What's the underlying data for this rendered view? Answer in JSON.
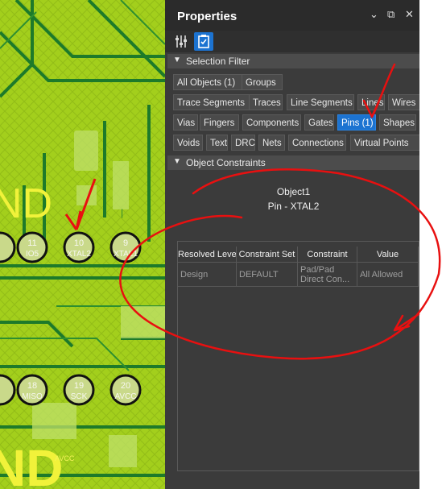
{
  "pcb": {
    "pins_top": [
      {
        "number": "11",
        "label": "IO5"
      },
      {
        "number": "10",
        "label": "XTAL2"
      },
      {
        "number": "9",
        "label": "XTAL1"
      }
    ],
    "pins_bottom": [
      {
        "number": "18",
        "label": "MISO"
      },
      {
        "number": "19",
        "label": "SCK"
      },
      {
        "number": "20",
        "label": "AVCC"
      }
    ],
    "big_text_top": "ND",
    "big_text_bottom": "ND",
    "small_avcc": "AVCC"
  },
  "panel": {
    "title": "Properties",
    "window_buttons": {
      "pin": "⌄",
      "restore": "⧉",
      "close": "✕"
    },
    "toolbar_icons": [
      "sliders-icon",
      "clipboard-check-icon"
    ],
    "selection_filter": {
      "header": "Selection Filter",
      "chips": [
        {
          "label": "All Objects (1)",
          "active": false
        },
        {
          "label": "Groups",
          "active": false
        },
        {
          "label": "Trace Segments",
          "active": false
        },
        {
          "label": "Traces",
          "active": false
        },
        {
          "label": "Line Segments",
          "active": false
        },
        {
          "label": "Lines",
          "active": false
        },
        {
          "label": "Wires",
          "active": false
        },
        {
          "label": "Vias",
          "active": false
        },
        {
          "label": "Fingers",
          "active": false
        },
        {
          "label": "Components",
          "active": false
        },
        {
          "label": "Gates",
          "active": false
        },
        {
          "label": "Pins (1)",
          "active": true
        },
        {
          "label": "Shapes",
          "active": false
        },
        {
          "label": "Voids",
          "active": false
        },
        {
          "label": "Text",
          "active": false
        },
        {
          "label": "DRC",
          "active": false
        },
        {
          "label": "Nets",
          "active": false
        },
        {
          "label": "Connections",
          "active": false
        },
        {
          "label": "Virtual Points",
          "active": false
        }
      ]
    },
    "object_constraints": {
      "header": "Object Constraints",
      "object_name": "Object1",
      "object_type": "Pin - XTAL2",
      "table": {
        "columns": [
          "Resolved Level",
          "Constraint Set",
          "Constraint",
          "Value"
        ],
        "rows": [
          [
            "Design",
            "DEFAULT",
            "Pad/Pad Direct Con...",
            "All Allowed"
          ]
        ]
      }
    }
  },
  "colors": {
    "annotation_red": "#e81010",
    "active_chip": "#1c73d1",
    "panel_bg": "#3b3b3b"
  }
}
